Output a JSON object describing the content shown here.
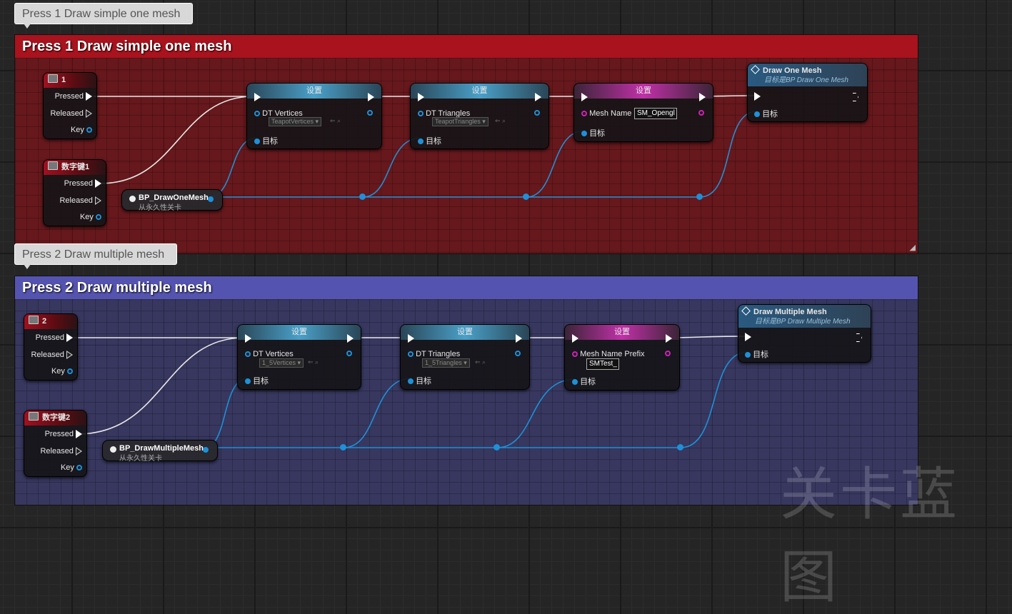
{
  "groups": [
    {
      "tab_label": "Press 1 Draw simple one mesh",
      "header": "Press 1 Draw simple one mesh",
      "header_color": "#a8131e",
      "event_a": {
        "title": "1",
        "pressed": "Pressed",
        "released": "Released",
        "key": "Key"
      },
      "event_b": {
        "title": "数字键1",
        "pressed": "Pressed",
        "released": "Released",
        "key": "Key"
      },
      "variable": {
        "name": "BP_DrawOneMesh",
        "sub": "从永久性关卡"
      },
      "set1": {
        "title": "设置",
        "var": "DT Vertices",
        "dropdown": "TeapotVertices",
        "target": "目标"
      },
      "set2": {
        "title": "设置",
        "var": "DT Triangles",
        "dropdown": "TeapotTriangles",
        "target": "目标"
      },
      "set3": {
        "title": "设置",
        "var": "Mesh Name",
        "value": "SM_Opengl",
        "target": "目标"
      },
      "func": {
        "title": "Draw One Mesh",
        "sub": "目标是BP Draw One Mesh",
        "target": "目标"
      }
    },
    {
      "tab_label": "Press 2 Draw multiple mesh",
      "header": "Press 2 Draw multiple mesh",
      "header_color": "#5454b0",
      "event_a": {
        "title": "2",
        "pressed": "Pressed",
        "released": "Released",
        "key": "Key"
      },
      "event_b": {
        "title": "数字键2",
        "pressed": "Pressed",
        "released": "Released",
        "key": "Key"
      },
      "variable": {
        "name": "BP_DrawMultipleMesh",
        "sub": "从永久性关卡"
      },
      "set1": {
        "title": "设置",
        "var": "DT Vertices",
        "dropdown": "1_5Vertices",
        "target": "目标"
      },
      "set2": {
        "title": "设置",
        "var": "DT Triangles",
        "dropdown": "1_5Triangles",
        "target": "目标"
      },
      "set3": {
        "title": "设置",
        "var": "Mesh Name Prefix",
        "value": "SMTest_",
        "target": "目标"
      },
      "func": {
        "title": "Draw Multiple Mesh",
        "sub": "目标是BP Draw Multiple Mesh",
        "target": "目标"
      }
    }
  ],
  "colors": {
    "exec_wire": "#e8e8e8",
    "object_wire": "#1e90d8",
    "string_pin": "#d020b8"
  },
  "watermark": "关卡蓝图"
}
